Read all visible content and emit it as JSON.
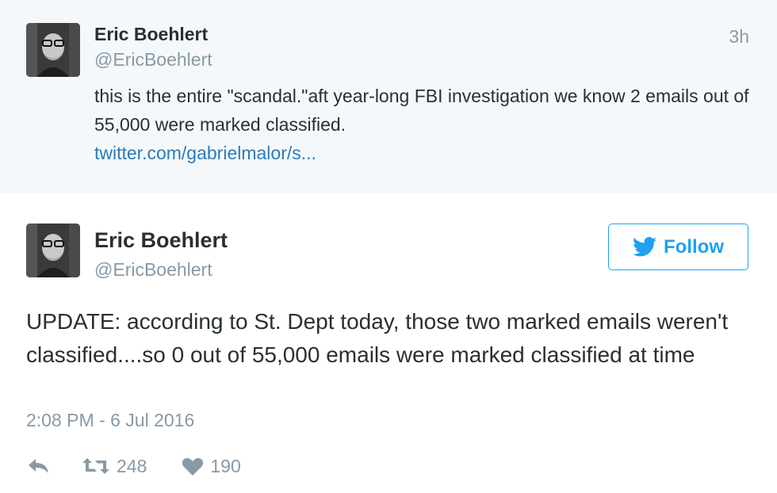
{
  "quoted_tweet": {
    "author_name": "Eric Boehlert",
    "author_handle": "@EricBoehlert",
    "time": "3h",
    "text": "this is the entire \"scandal.\"aft year-long FBI investigation we know 2 emails out of 55,000 were marked classified.",
    "link": "twitter.com/gabrielmalor/s..."
  },
  "main_tweet": {
    "author_name": "Eric Boehlert",
    "author_handle": "@EricBoehlert",
    "follow_label": "Follow",
    "text": "UPDATE: according to St. Dept today, those two marked emails weren't classified....so 0 out of 55,000 emails were marked classified at time",
    "timestamp": "2:08 PM - 6 Jul 2016",
    "retweets": "248",
    "likes": "190"
  },
  "icons": {
    "avatar": "avatar-photo",
    "follow": "twitter-bird-icon",
    "reply": "reply-icon",
    "retweet": "retweet-icon",
    "like": "heart-icon"
  },
  "colors": {
    "twitter_blue": "#1da1f2",
    "link_blue": "#2b7bb9",
    "muted_gray": "#8899a6",
    "text_dark": "#292f33",
    "quoted_background": "#f5f8fa"
  }
}
